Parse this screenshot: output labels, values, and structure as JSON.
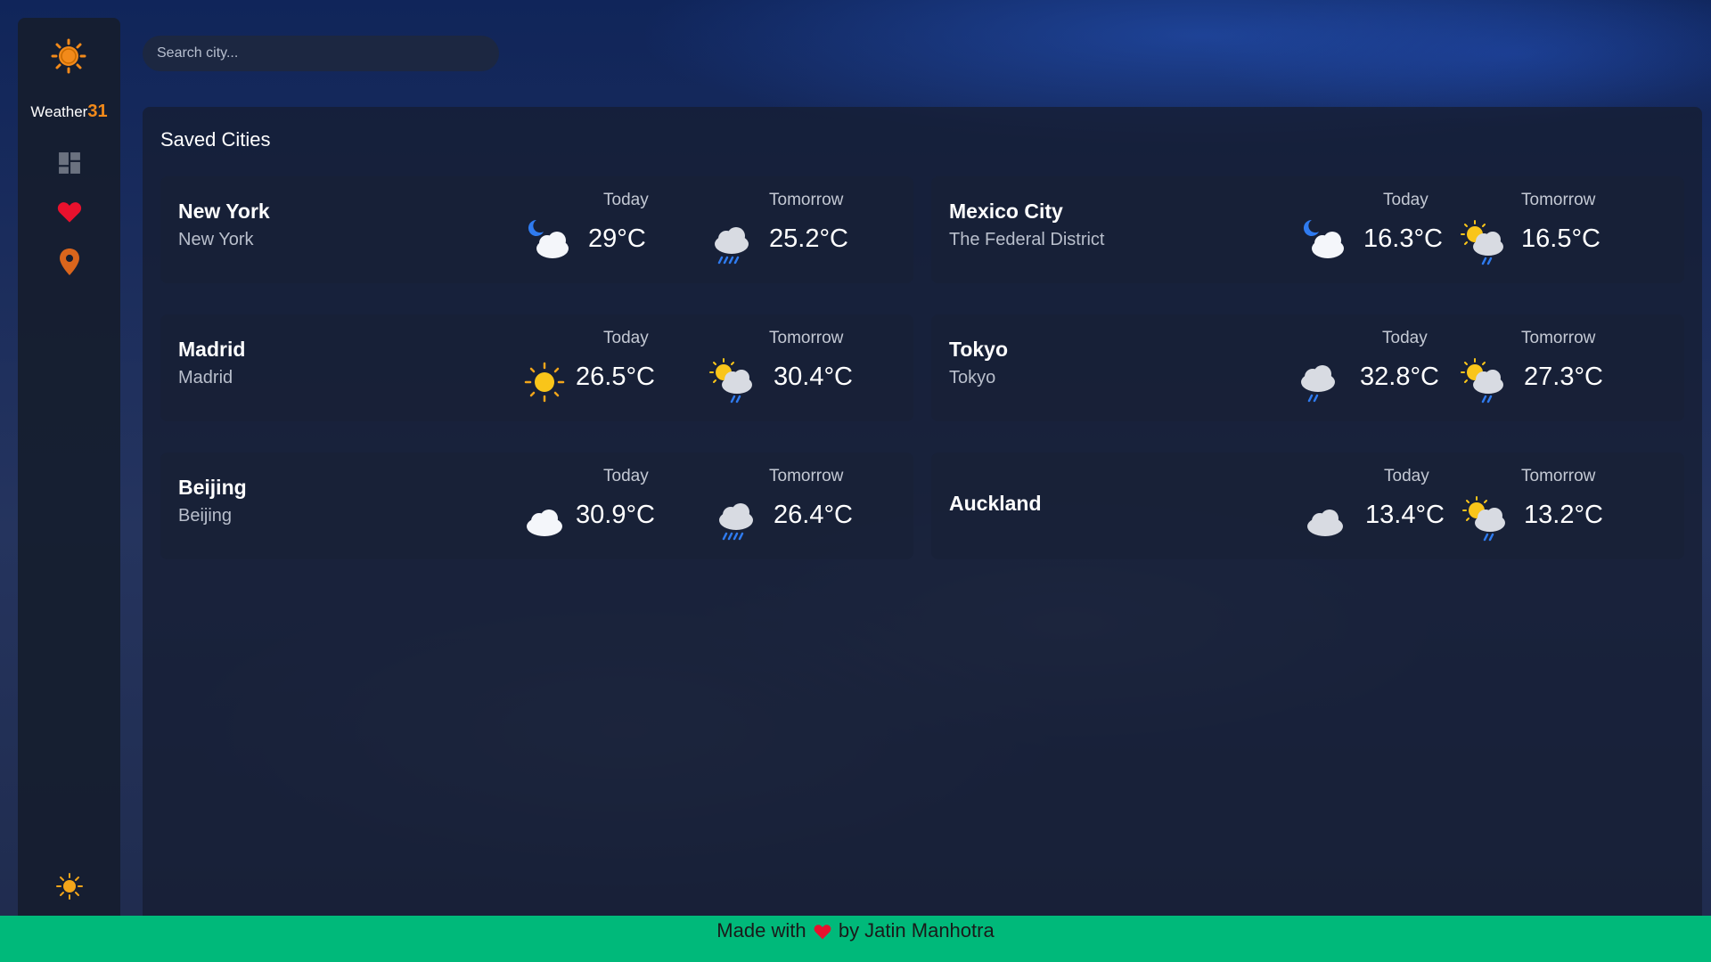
{
  "app": {
    "brand_text": "Weather",
    "brand_number": "31"
  },
  "search": {
    "placeholder": "Search city..."
  },
  "nav": {
    "items": [
      {
        "icon": "dashboard-icon",
        "color": "#6b7280"
      },
      {
        "icon": "heart-icon",
        "color": "#e8112d"
      },
      {
        "icon": "location-pin-icon",
        "color": "#d9651c"
      }
    ]
  },
  "main": {
    "title": "Saved Cities",
    "cities": [
      {
        "name": "New York",
        "region": "New York",
        "today_label": "Today",
        "today_temp": "29°C",
        "today_icon": "night-cloudy-icon",
        "tomorrow_label": "Tomorrow",
        "tomorrow_temp": "25.2°C",
        "tomorrow_icon": "rain-heavy-icon"
      },
      {
        "name": "Mexico City",
        "region": "The Federal District",
        "today_label": "Today",
        "today_temp": "16.3°C",
        "today_icon": "night-cloudy-icon",
        "tomorrow_label": "Tomorrow",
        "tomorrow_temp": "16.5°C",
        "tomorrow_icon": "sun-cloud-rain-icon"
      },
      {
        "name": "Madrid",
        "region": "Madrid",
        "today_label": "Today",
        "today_temp": "26.5°C",
        "today_icon": "sunny-icon",
        "tomorrow_label": "Tomorrow",
        "tomorrow_temp": "30.4°C",
        "tomorrow_icon": "sun-cloud-rain-icon"
      },
      {
        "name": "Tokyo",
        "region": "Tokyo",
        "today_label": "Today",
        "today_temp": "32.8°C",
        "today_icon": "rain-light-icon",
        "tomorrow_label": "Tomorrow",
        "tomorrow_temp": "27.3°C",
        "tomorrow_icon": "sun-cloud-rain-icon"
      },
      {
        "name": "Beijing",
        "region": "Beijing",
        "today_label": "Today",
        "today_temp": "30.9°C",
        "today_icon": "cloudy-icon",
        "tomorrow_label": "Tomorrow",
        "tomorrow_temp": "26.4°C",
        "tomorrow_icon": "rain-heavy-icon"
      },
      {
        "name": "Auckland",
        "region": "",
        "today_label": "Today",
        "today_temp": "13.4°C",
        "today_icon": "cloudy-icon",
        "tomorrow_label": "Tomorrow",
        "tomorrow_temp": "13.2°C",
        "tomorrow_icon": "sun-cloud-rain-icon"
      }
    ]
  },
  "footer": {
    "prefix": "Made with",
    "suffix": "by Jatin Manhotra"
  },
  "colors": {
    "accent_orange": "#f28a1a",
    "footer_green": "#00b97a",
    "heart_red": "#e8112d"
  }
}
